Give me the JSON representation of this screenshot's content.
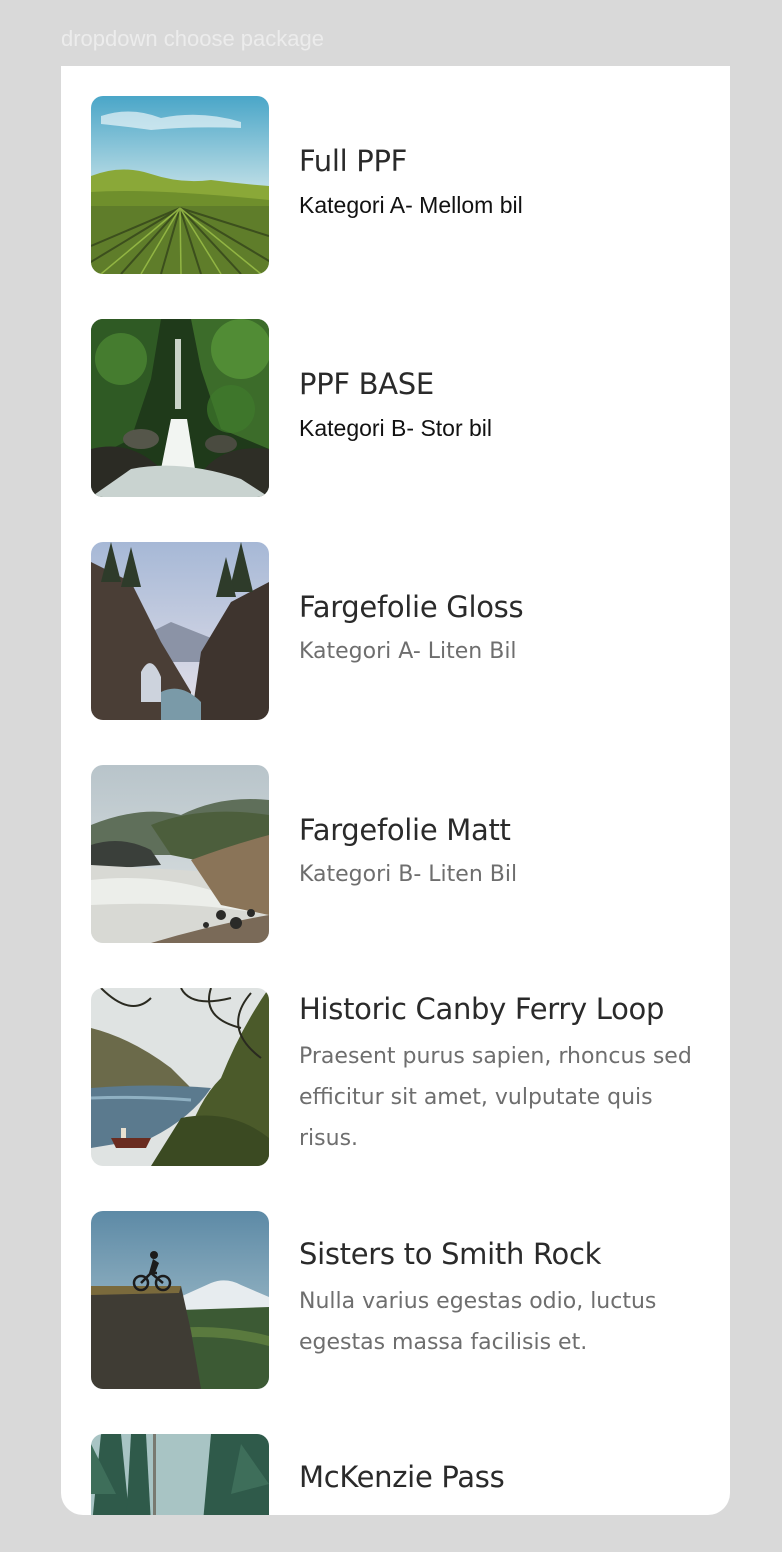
{
  "frame": {
    "label": "dropdown choose package"
  },
  "packages": [
    {
      "title": "Full PPF",
      "subtitle": "Kategori A- Mellom bil",
      "image_icon": "vineyard-photo"
    },
    {
      "title": "PPF BASE",
      "subtitle": "Kategori B- Stor bil",
      "image_icon": "waterfall-photo"
    },
    {
      "title": "Fargefolie Gloss",
      "subtitle": "Kategori A- Liten Bil",
      "image_icon": "rock-arch-photo"
    },
    {
      "title": "Fargefolie Matt",
      "subtitle": "Kategori B- Liten Bil",
      "image_icon": "coast-photo"
    },
    {
      "title": "Historic Canby Ferry Loop",
      "description_lines": [
        "Praesent purus sapien, rhoncus sed",
        "efficitur sit amet, vulputate quis",
        "risus."
      ],
      "image_icon": "river-boat-photo"
    },
    {
      "title": "Sisters to Smith Rock",
      "description_lines": [
        "Nulla varius egestas odio, luctus",
        "egestas massa facilisis et."
      ],
      "image_icon": "mountain-biker-photo"
    },
    {
      "title": "McKenzie Pass",
      "image_icon": "forest-photo"
    }
  ],
  "colors": {
    "background": "#d9d9d9",
    "panel": "#ffffff",
    "title": "#2a2a2a",
    "muted": "#6e6e6e"
  }
}
